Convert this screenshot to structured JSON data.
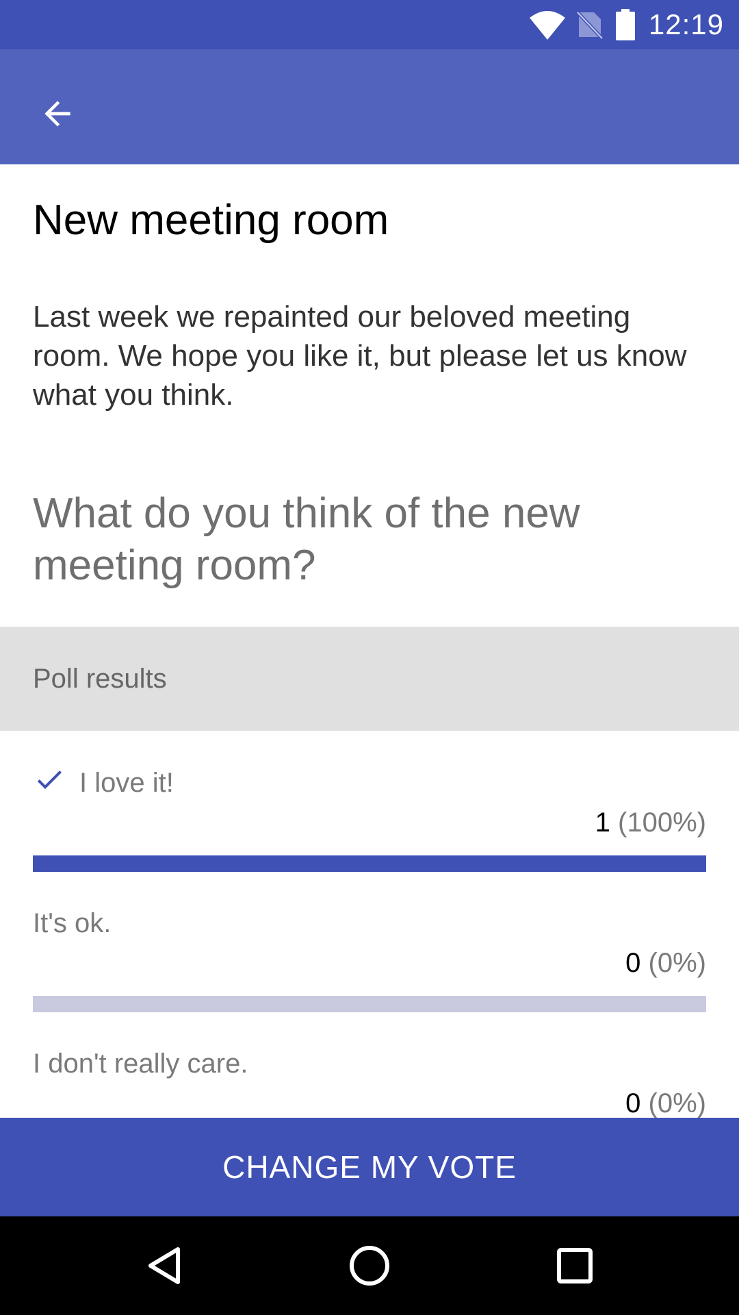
{
  "status_bar": {
    "time": "12:19",
    "icons": [
      "wifi-icon",
      "no-sim-icon",
      "battery-icon"
    ]
  },
  "app_bar": {
    "back_icon": "arrow-back-icon"
  },
  "poll": {
    "title": "New meeting room",
    "description": "Last week we repainted our beloved meeting room. We hope you like it, but please let us know what you think.",
    "question": "What do you think of the new meeting room?",
    "results_header": "Poll results",
    "options": [
      {
        "label": "I love it!",
        "count": "1",
        "percent_text": "(100%)",
        "fraction": 1.0,
        "voted": true
      },
      {
        "label": "It's ok.",
        "count": "0",
        "percent_text": "(0%)",
        "fraction": 0.0,
        "voted": false
      },
      {
        "label": "I don't really care.",
        "count": "0",
        "percent_text": "(0%)",
        "fraction": 0.0,
        "voted": false
      }
    ]
  },
  "action": {
    "change_vote_label": "CHANGE MY VOTE"
  },
  "colors": {
    "primary": "#3f51b5",
    "app_bar": "#5163bd",
    "bar_track": "#c9cae0",
    "header_bg": "#e0e0e0"
  }
}
